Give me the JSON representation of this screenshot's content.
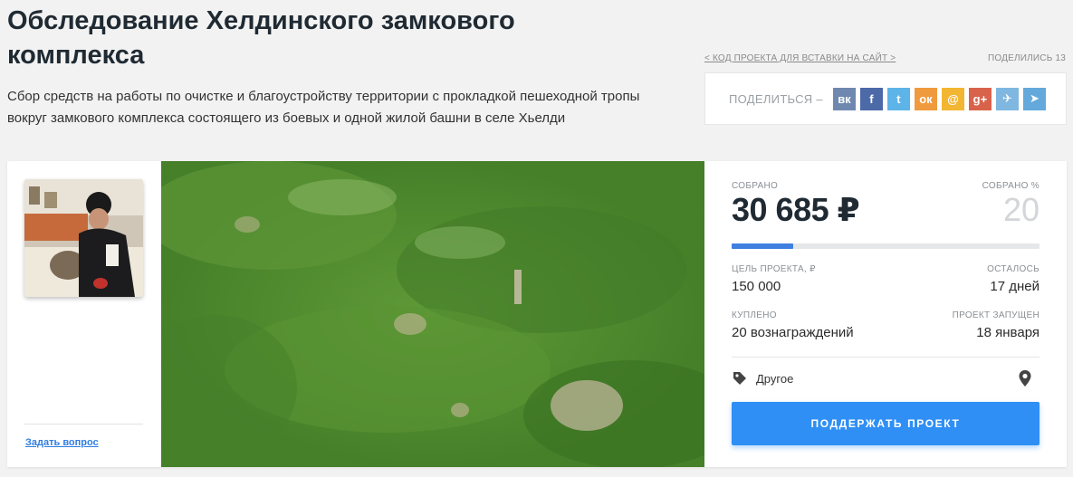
{
  "header": {
    "title": "Обследование Хелдинского замкового комплекса",
    "description": "Сбор средств на работы по очистке и благоустройству территории с прокладкой пешеходной тропы вокруг замкового комплекса состоящего из боевых и одной жилой башни в селе Хьелди"
  },
  "share": {
    "embed_link": "< КОД ПРОЕКТА ДЛЯ ВСТАВКИ НА САЙТ >",
    "shared_count": "ПОДЕЛИЛИСЬ 13",
    "label": "ПОДЕЛИТЬСЯ –",
    "networks": [
      {
        "name": "vk",
        "glyph": "вк",
        "color": "#6f88b0"
      },
      {
        "name": "facebook",
        "glyph": "f",
        "color": "#4c6aa8"
      },
      {
        "name": "twitter",
        "glyph": "t",
        "color": "#5db4e8"
      },
      {
        "name": "odnoklassniki",
        "glyph": "ок",
        "color": "#f09a3e"
      },
      {
        "name": "mail",
        "glyph": "@",
        "color": "#f2b632"
      },
      {
        "name": "google-plus",
        "glyph": "g+",
        "color": "#d9624b"
      },
      {
        "name": "livejournal",
        "glyph": "✈",
        "color": "#7fb7e0"
      },
      {
        "name": "telegram",
        "glyph": "➤",
        "color": "#64a9dc"
      }
    ]
  },
  "sidebar": {
    "ask_question": "Задать вопрос"
  },
  "stats": {
    "collected_label": "СОБРАНО",
    "collected_value": "30 685 ₽",
    "percent_label": "СОБРАНО %",
    "percent_value": "20",
    "progress_fraction": 0.2,
    "goal_label": "ЦЕЛЬ ПРОЕКТА, ₽",
    "goal_value": "150 000",
    "remaining_label": "ОСТАЛОСЬ",
    "remaining_value": "17 дней",
    "bought_label": "КУПЛЕНО",
    "bought_value": "20 вознаграждений",
    "launched_label": "ПРОЕКТ ЗАПУЩЕН",
    "launched_value": "18 января",
    "category": "Другое",
    "support_button": "ПОДДЕРЖАТЬ ПРОЕКТ"
  }
}
